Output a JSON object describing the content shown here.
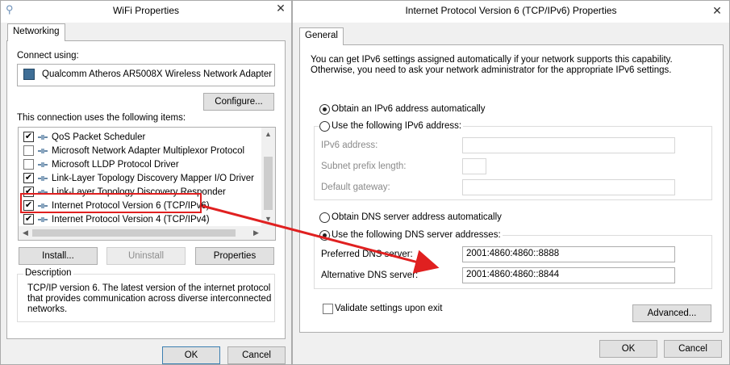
{
  "left_window": {
    "title": "WiFi Properties",
    "tab": "Networking",
    "connect_using_label": "Connect using:",
    "adapter_name": "Qualcomm Atheros AR5008X Wireless Network Adapter",
    "configure_button": "Configure...",
    "items_label": "This connection uses the following items:",
    "items": [
      {
        "label": "QoS Packet Scheduler",
        "checked": true,
        "icon": "qos-icon"
      },
      {
        "label": "Microsoft Network Adapter Multiplexor Protocol",
        "checked": false,
        "icon": "protocol-icon"
      },
      {
        "label": "Microsoft LLDP Protocol Driver",
        "checked": false,
        "icon": "protocol-icon"
      },
      {
        "label": "Link-Layer Topology Discovery Mapper I/O Driver",
        "checked": true,
        "icon": "protocol-icon"
      },
      {
        "label": "Link-Layer Topology Discovery Responder",
        "checked": true,
        "icon": "protocol-icon"
      },
      {
        "label": "Internet Protocol Version 6 (TCP/IPv6)",
        "checked": true,
        "icon": "protocol-icon"
      },
      {
        "label": "Internet Protocol Version 4 (TCP/IPv4)",
        "checked": true,
        "icon": "protocol-icon"
      }
    ],
    "install_button": "Install...",
    "uninstall_button": "Uninstall",
    "properties_button": "Properties",
    "description_label": "Description",
    "description_text_1": "TCP/IP version 6. The latest version of the internet protocol",
    "description_text_2": "that provides communication across diverse interconnected",
    "description_text_3": "networks.",
    "ok_button": "OK",
    "cancel_button": "Cancel"
  },
  "right_window": {
    "title": "Internet Protocol Version 6 (TCP/IPv6) Properties",
    "tab": "General",
    "intro_1": "You can get IPv6 settings assigned automatically if your network supports this capability.",
    "intro_2": "Otherwise, you need to ask your network administrator for the appropriate IPv6 settings.",
    "obtain_ipv6_auto": "Obtain an IPv6 address automatically",
    "use_following_ipv6": "Use the following IPv6 address:",
    "ipv6_address_label": "IPv6 address:",
    "subnet_prefix_label": "Subnet prefix length:",
    "default_gateway_label": "Default gateway:",
    "obtain_dns_auto": "Obtain DNS server address automatically",
    "use_following_dns": "Use the following DNS server addresses:",
    "preferred_dns_label": "Preferred DNS server:",
    "preferred_dns_value": "2001:4860:4860::8888",
    "alternative_dns_label": "Alternative DNS server:",
    "alternative_dns_value": "2001:4860:4860::8844",
    "validate_label": "Validate settings upon exit",
    "advanced_button": "Advanced...",
    "ok_button": "OK",
    "cancel_button": "Cancel"
  },
  "colors": {
    "annotation_red": "#e02020"
  }
}
